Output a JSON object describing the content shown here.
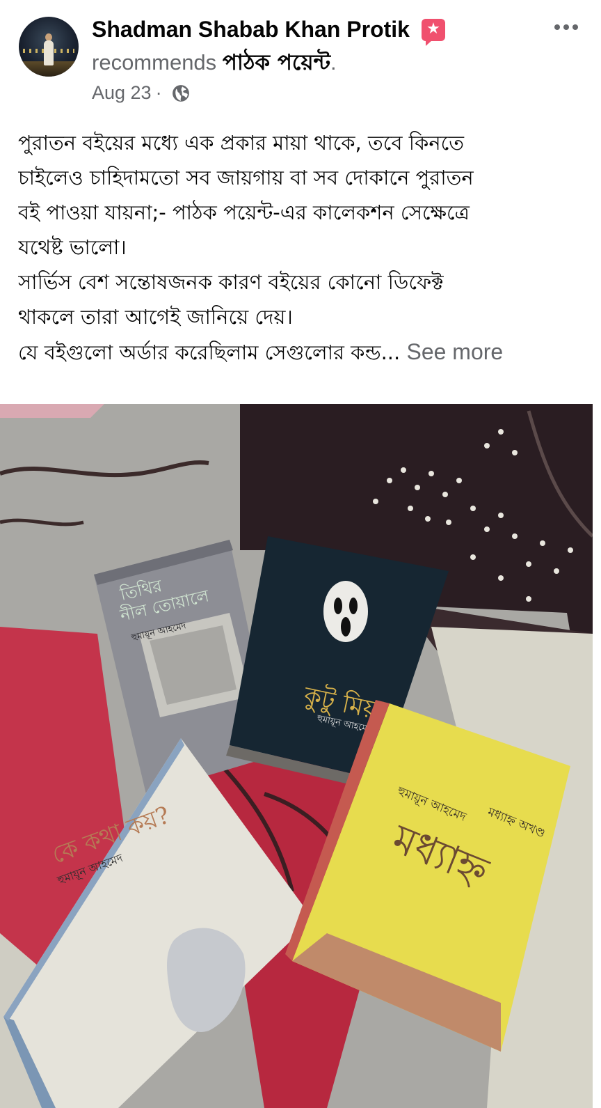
{
  "post": {
    "author": {
      "name": "Shadman Shabab Khan Protik",
      "badge_icon": "recommendation-badge-icon"
    },
    "recommends_text": "recommends",
    "page_name": "পাঠক পয়েন্ট",
    "page_name_suffix": ".",
    "date": "Aug 23",
    "separator": "·",
    "privacy_icon": "globe-icon",
    "more_icon": "more-options-icon",
    "text_lines": [
      "পুরাতন বইয়ের মধ্যে এক প্রকার মায়া থাকে, তবে কিনতে",
      "চাইলেও চাহিদামতো সব জায়গায় বা সব দোকানে পুরাতন",
      "বই পাওয়া যায়না;- পাঠক পয়েন্ট-এর কালেকশন সেক্ষেত্রে",
      "যথেষ্ট ভালো।",
      "সার্ভিস বেশ সন্তোষজনক কারণ বইয়ের কোনো ডিফেক্ট",
      "থাকলে তারা আগেই জানিয়ে দেয়।",
      "যে বইগুলো অর্ডার করেছিলাম সেগুলোর কন্ড..."
    ],
    "see_more": "See more",
    "photo": {
      "books": [
        {
          "title_line1": "তিথির",
          "title_line2": "নীল তোয়ালে",
          "author": "হুমায়ূন আহমেদ"
        },
        {
          "title": "কুটু মিয়া",
          "author": "হুমায়ূন আহমেদ"
        },
        {
          "title": "কে কথা কয়?",
          "author": "হুমায়ূন আহমেদ"
        },
        {
          "title": "মধ্যাহ্ন",
          "author": "হুমায়ূন আহমেদ",
          "subtitle": "মধ্যাহ্ন অখণ্ড"
        }
      ]
    }
  }
}
